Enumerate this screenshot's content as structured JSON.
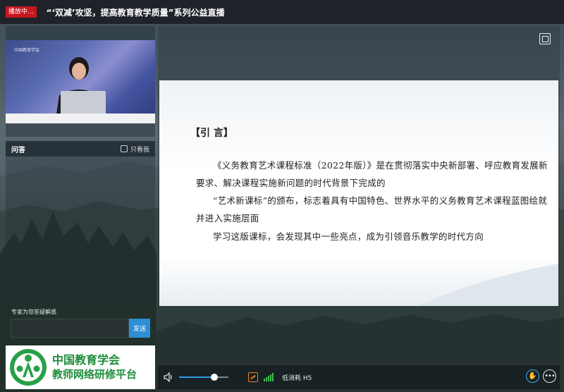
{
  "header": {
    "live_badge": "播放中...",
    "title": "“‘双减’攻坚，提高教育教学质量”系列公益直播"
  },
  "video": {
    "watermark": "中国教育学会"
  },
  "qa": {
    "title": "问答",
    "only_mine_label": "只看我",
    "only_mine_checked": false,
    "ask_label": "专家为您答疑解惑",
    "input_value": "",
    "send_label": "发送"
  },
  "brand": {
    "line1": "中国教育学会",
    "line2": "教师网络研修平台",
    "color": "#1f8c3a"
  },
  "slide": {
    "heading": "【引 言】",
    "paragraph1": "《义务教育艺术课程标准（2022年版）》是在贯彻落实中央新部署、呼应教育发展新要求、解决课程实施新问题的时代背景下完成的",
    "paragraph2": "“艺术新课标”的颁布，标志着具有中国特色、世界水平的义务教育艺术课程蓝图绘就并进入实施层面",
    "paragraph3": "学习这版课标，会发现其中一些亮点，成为引领音乐教学的时代方向"
  },
  "controls": {
    "volume_fraction": 0.72,
    "quality_label": "低消耗 H5",
    "accent_color": "#2d9be3",
    "icons": [
      "volume-icon",
      "quality-icon",
      "signal-icon",
      "hand-raise-icon",
      "more-icon",
      "expand-icon"
    ]
  }
}
